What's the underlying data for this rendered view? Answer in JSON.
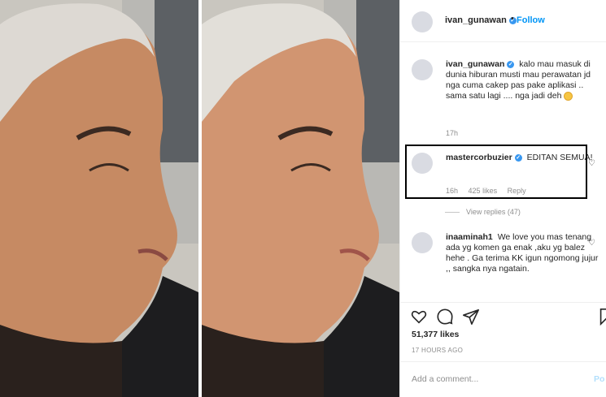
{
  "post": {
    "author": "ivan_gunawan",
    "follow_dot": "•",
    "follow_label": "Follow"
  },
  "comments": [
    {
      "username": "ivan_gunawan",
      "text": "kalo mau masuk di dunia hiburan musti mau perawatan jd nga cuma cakep pas pake aplikasi .. sama satu lagi .... nga jadi deh",
      "time": "17h"
    },
    {
      "username": "mastercorbuzier",
      "text": "EDITAN SEMUA!",
      "time": "16h",
      "likes": "425 likes",
      "reply": "Reply",
      "view_replies": "View replies (47)"
    },
    {
      "username": "inaaminah1",
      "text": "We love you mas tenang ada yg komen ga enak ,aku yg balez hehe . Ga terima KK igun ngomong jujur ,, sangka nya ngatain."
    }
  ],
  "actions": {
    "likes": "51,377 likes",
    "timestamp": "17 HOURS AGO"
  },
  "add_comment": {
    "placeholder": "Add a comment...",
    "post_label": "Po"
  },
  "colors": {
    "accent": "#0095f6",
    "verified": "#3897f0",
    "muted": "#8e8e8e"
  }
}
